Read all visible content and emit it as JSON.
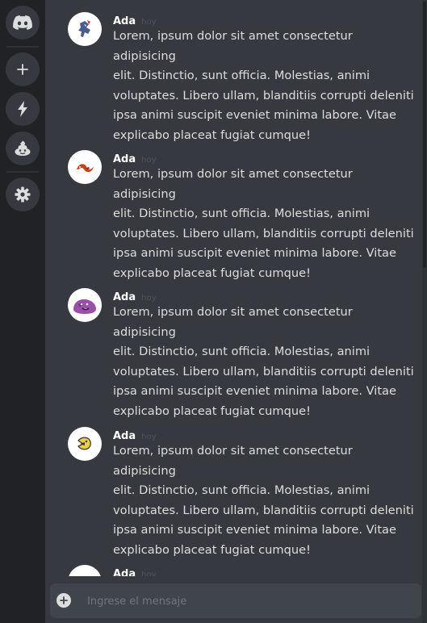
{
  "input": {
    "placeholder": "Ingrese el mensaje"
  },
  "messages": [
    {
      "author": "Ada",
      "time": "hoy",
      "text": "Lorem, ipsum dolor sit amet consectetur adipisicing\nelit. Distinctio, sunt officia. Molestias, animi\nvoluptates. Libero ullam, blanditiis corrupti deleniti\nipsa animi suscipit eveniet minima labore. Vitae\nexplicabo placeat fugiat cumque!"
    },
    {
      "author": "Ada",
      "time": "hoy",
      "text": "Lorem, ipsum dolor sit amet consectetur adipisicing\nelit. Distinctio, sunt officia. Molestias, animi\nvoluptates. Libero ullam, blanditiis corrupti deleniti\nipsa animi suscipit eveniet minima labore. Vitae\nexplicabo placeat fugiat cumque!"
    },
    {
      "author": "Ada",
      "time": "hoy",
      "text": "Lorem, ipsum dolor sit amet consectetur adipisicing\nelit. Distinctio, sunt officia. Molestias, animi\nvoluptates. Libero ullam, blanditiis corrupti deleniti\nipsa animi suscipit eveniet minima labore. Vitae\nexplicabo placeat fugiat cumque!"
    },
    {
      "author": "Ada",
      "time": "hoy",
      "text": "Lorem, ipsum dolor sit amet consectetur adipisicing\nelit. Distinctio, sunt officia. Molestias, animi\nvoluptates. Libero ullam, blanditiis corrupti deleniti\nipsa animi suscipit eveniet minima labore. Vitae\nexplicabo placeat fugiat cumque!"
    },
    {
      "author": "Ada",
      "time": "hoy",
      "text": ""
    }
  ]
}
